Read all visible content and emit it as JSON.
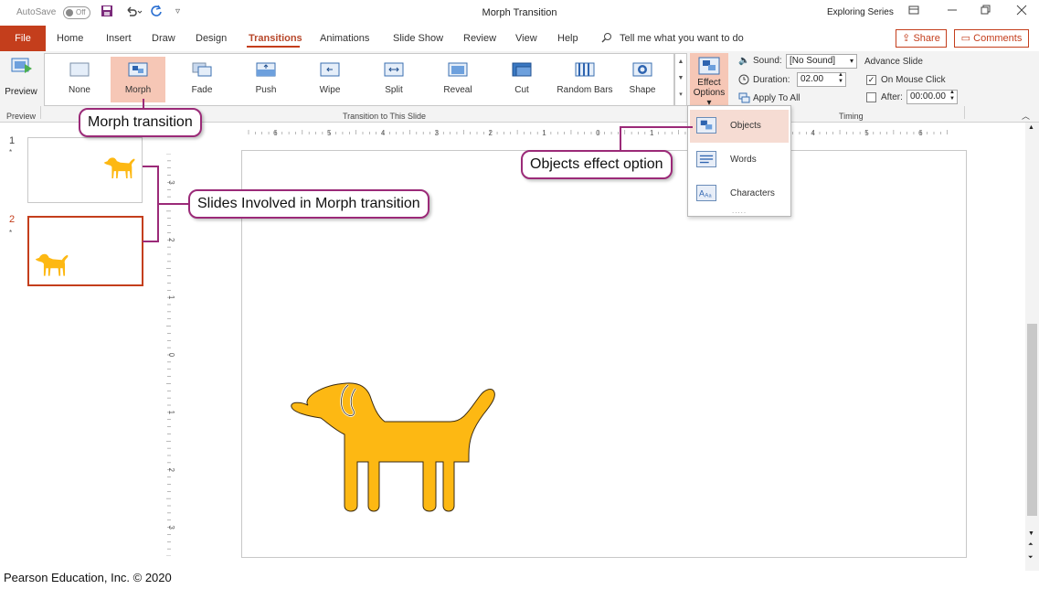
{
  "titlebar": {
    "autosave_label": "AutoSave",
    "autosave_state": "Off",
    "doc_title": "Morph Transition",
    "account": "Exploring Series"
  },
  "tabs": {
    "file": "File",
    "items": [
      "Home",
      "Insert",
      "Draw",
      "Design",
      "Transitions",
      "Animations",
      "Slide Show",
      "Review",
      "View",
      "Help"
    ],
    "active": "Transitions",
    "tell_me": "Tell me what you want to do",
    "share": "Share",
    "comments": "Comments"
  },
  "ribbon": {
    "preview_label": "Preview",
    "preview_group": "Preview",
    "transitions": [
      "None",
      "Morph",
      "Fade",
      "Push",
      "Wipe",
      "Split",
      "Reveal",
      "Cut",
      "Random Bars",
      "Shape"
    ],
    "selected_transition": "Morph",
    "gallery_group": "Transition to This Slide",
    "effect_options_line1": "Effect",
    "effect_options_line2": "Options",
    "sound_label": "Sound:",
    "sound_value": "[No Sound]",
    "duration_label": "Duration:",
    "duration_value": "02.00",
    "apply_all": "Apply To All",
    "advance_slide": "Advance Slide",
    "on_mouse_click": "On Mouse Click",
    "on_mouse_click_checked": true,
    "after_label": "After:",
    "after_value": "00:00.00",
    "timing_group": "Timing",
    "accent_color": "#c43e1c",
    "selected_fill": "#f6c7b6"
  },
  "slides": [
    {
      "number": "1",
      "marker": "*",
      "selected": false
    },
    {
      "number": "2",
      "marker": "*",
      "selected": true
    }
  ],
  "effect_menu": {
    "items": [
      "Objects",
      "Words",
      "Characters"
    ],
    "selected": "Objects",
    "more_dots": "....."
  },
  "rulers": {
    "horizontal": [
      "6",
      "5",
      "4",
      "3",
      "2",
      "1",
      "0",
      "1",
      "2",
      "3",
      "4",
      "5",
      "6"
    ],
    "vertical": [
      "3",
      "2",
      "1",
      "0",
      "1",
      "2",
      "3"
    ]
  },
  "callouts": {
    "morph": "Morph transition",
    "slides": "Slides Involved in Morph transition",
    "objects": "Objects effect option"
  },
  "colors": {
    "dog": "#fdb813",
    "callout_border": "#9b2a78"
  },
  "footer": {
    "copyright": "Pearson Education, Inc. © 2020"
  }
}
